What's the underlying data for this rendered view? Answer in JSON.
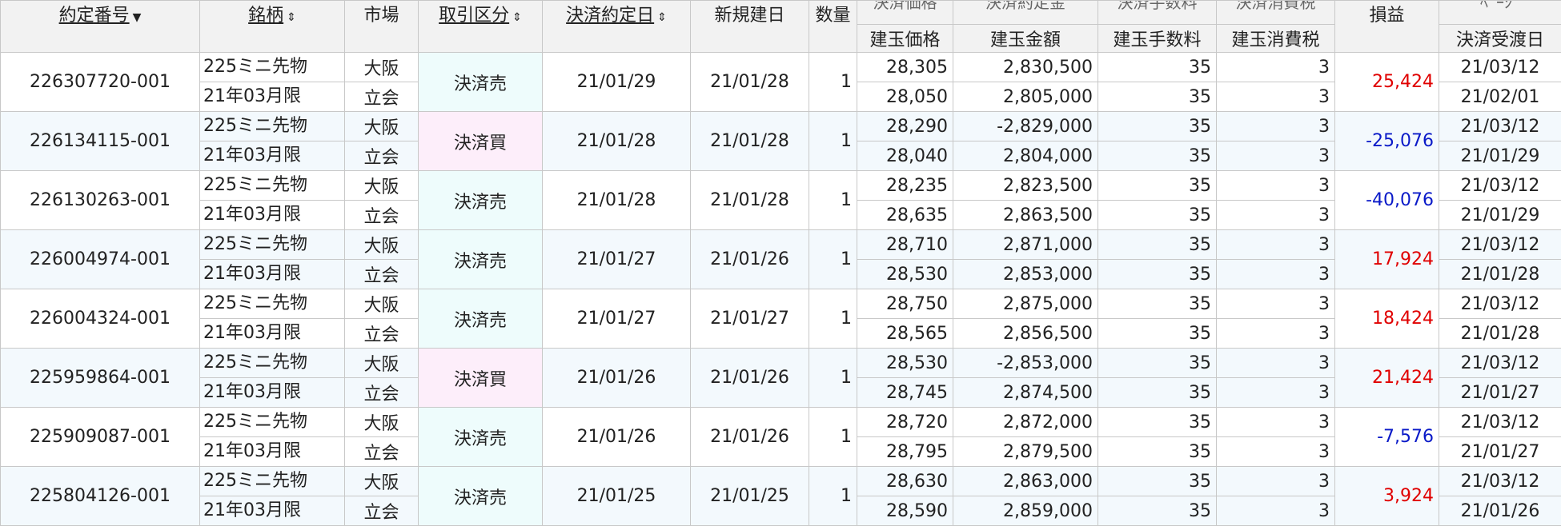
{
  "headers": {
    "contract_no": "約定番号",
    "contract_no_arrow": "▼",
    "brand": "銘柄",
    "sort_arrow": "⇕",
    "market": "市場",
    "trade_type": "取引区分",
    "settle_date": "決済約定日",
    "open_date": "新規建日",
    "quantity": "数量",
    "open_price": "建玉価格",
    "open_amount": "建玉金額",
    "open_fee": "建玉手数料",
    "open_tax": "建玉消費税",
    "pnl": "損益",
    "delivery_date": "決済受渡日",
    "cut_price": "決済価格",
    "cut_amount": "決済約定金",
    "cut_fee": "決済手数料",
    "cut_tax": "決済消費税",
    "cut_right": "ﾍﾟｰｼﾞ"
  },
  "rows": [
    {
      "no": "226307720-001",
      "brand1": "225ミニ先物",
      "brand2": "21年03月限",
      "market1": "大阪",
      "market2": "立会",
      "type": "決済売",
      "kind": "sell",
      "settle": "21/01/29",
      "open": "21/01/28",
      "qty": "1",
      "price1": "28,305",
      "price2": "28,050",
      "amount1": "2,830,500",
      "amount2": "2,805,000",
      "fee1": "35",
      "fee2": "35",
      "tax1": "3",
      "tax2": "3",
      "pnl": "25,424",
      "sign": "pos",
      "date1": "21/03/12",
      "date2": "21/02/01"
    },
    {
      "no": "226134115-001",
      "brand1": "225ミニ先物",
      "brand2": "21年03月限",
      "market1": "大阪",
      "market2": "立会",
      "type": "決済買",
      "kind": "buy",
      "settle": "21/01/28",
      "open": "21/01/28",
      "qty": "1",
      "price1": "28,290",
      "price2": "28,040",
      "amount1": "-2,829,000",
      "amount2": "2,804,000",
      "fee1": "35",
      "fee2": "35",
      "tax1": "3",
      "tax2": "3",
      "pnl": "-25,076",
      "sign": "neg",
      "date1": "21/03/12",
      "date2": "21/01/29"
    },
    {
      "no": "226130263-001",
      "brand1": "225ミニ先物",
      "brand2": "21年03月限",
      "market1": "大阪",
      "market2": "立会",
      "type": "決済売",
      "kind": "sell",
      "settle": "21/01/28",
      "open": "21/01/28",
      "qty": "1",
      "price1": "28,235",
      "price2": "28,635",
      "amount1": "2,823,500",
      "amount2": "2,863,500",
      "fee1": "35",
      "fee2": "35",
      "tax1": "3",
      "tax2": "3",
      "pnl": "-40,076",
      "sign": "neg",
      "date1": "21/03/12",
      "date2": "21/01/29"
    },
    {
      "no": "226004974-001",
      "brand1": "225ミニ先物",
      "brand2": "21年03月限",
      "market1": "大阪",
      "market2": "立会",
      "type": "決済売",
      "kind": "sell",
      "settle": "21/01/27",
      "open": "21/01/26",
      "qty": "1",
      "price1": "28,710",
      "price2": "28,530",
      "amount1": "2,871,000",
      "amount2": "2,853,000",
      "fee1": "35",
      "fee2": "35",
      "tax1": "3",
      "tax2": "3",
      "pnl": "17,924",
      "sign": "pos",
      "date1": "21/03/12",
      "date2": "21/01/28"
    },
    {
      "no": "226004324-001",
      "brand1": "225ミニ先物",
      "brand2": "21年03月限",
      "market1": "大阪",
      "market2": "立会",
      "type": "決済売",
      "kind": "sell",
      "settle": "21/01/27",
      "open": "21/01/27",
      "qty": "1",
      "price1": "28,750",
      "price2": "28,565",
      "amount1": "2,875,000",
      "amount2": "2,856,500",
      "fee1": "35",
      "fee2": "35",
      "tax1": "3",
      "tax2": "3",
      "pnl": "18,424",
      "sign": "pos",
      "date1": "21/03/12",
      "date2": "21/01/28"
    },
    {
      "no": "225959864-001",
      "brand1": "225ミニ先物",
      "brand2": "21年03月限",
      "market1": "大阪",
      "market2": "立会",
      "type": "決済買",
      "kind": "buy",
      "settle": "21/01/26",
      "open": "21/01/26",
      "qty": "1",
      "price1": "28,530",
      "price2": "28,745",
      "amount1": "-2,853,000",
      "amount2": "2,874,500",
      "fee1": "35",
      "fee2": "35",
      "tax1": "3",
      "tax2": "3",
      "pnl": "21,424",
      "sign": "pos",
      "date1": "21/03/12",
      "date2": "21/01/27"
    },
    {
      "no": "225909087-001",
      "brand1": "225ミニ先物",
      "brand2": "21年03月限",
      "market1": "大阪",
      "market2": "立会",
      "type": "決済売",
      "kind": "sell",
      "settle": "21/01/26",
      "open": "21/01/26",
      "qty": "1",
      "price1": "28,720",
      "price2": "28,795",
      "amount1": "2,872,000",
      "amount2": "2,879,500",
      "fee1": "35",
      "fee2": "35",
      "tax1": "3",
      "tax2": "3",
      "pnl": "-7,576",
      "sign": "neg",
      "date1": "21/03/12",
      "date2": "21/01/27"
    },
    {
      "no": "225804126-001",
      "brand1": "225ミニ先物",
      "brand2": "21年03月限",
      "market1": "大阪",
      "market2": "立会",
      "type": "決済売",
      "kind": "sell",
      "settle": "21/01/25",
      "open": "21/01/25",
      "qty": "1",
      "price1": "28,630",
      "price2": "28,590",
      "amount1": "2,863,000",
      "amount2": "2,859,000",
      "fee1": "35",
      "fee2": "35",
      "tax1": "3",
      "tax2": "3",
      "pnl": "3,924",
      "sign": "pos",
      "date1": "21/03/12",
      "date2": "21/01/26"
    }
  ],
  "colors": {
    "sell_bg": "#eefcfc",
    "buy_bg": "#fdeefa",
    "positive": "#e00000",
    "negative": "#0a1ac8",
    "alt_row": "#f3f9fd"
  }
}
